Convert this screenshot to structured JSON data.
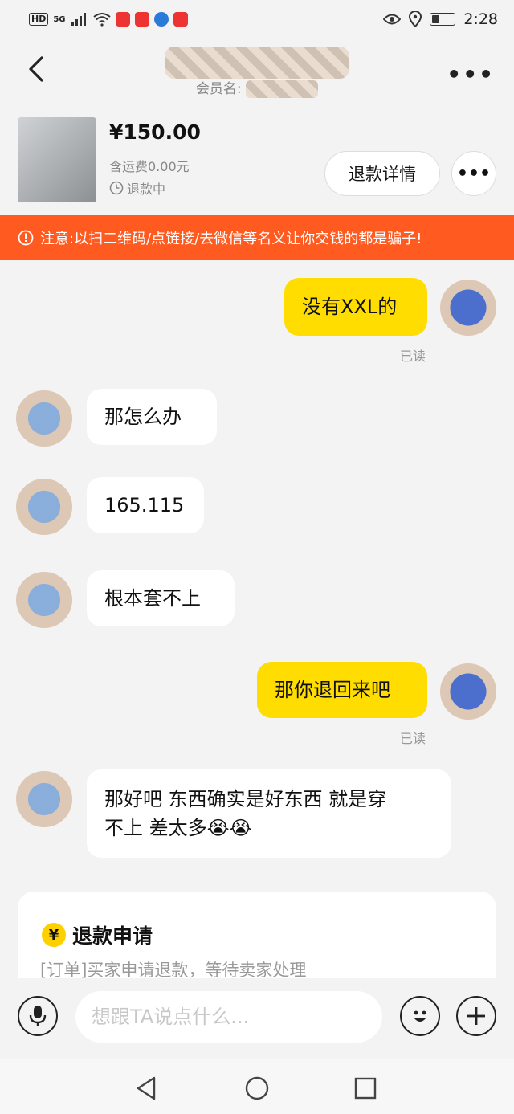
{
  "status_bar": {
    "hd": "HD",
    "signal": "5G",
    "time": "2:28"
  },
  "header": {
    "back_icon": "chevron-left-icon",
    "member_label": "会员名:",
    "more_icon": "more-horizontal-icon"
  },
  "product": {
    "price": "¥150.00",
    "shipping": "含运费0.00元",
    "status": "退款中",
    "refund_detail_button": "退款详情",
    "more_button": "•••"
  },
  "warning": {
    "icon": "alert-circle-icon",
    "text": "注意:以扫二维码/点链接/去微信等名义让你交钱的都是骗子!"
  },
  "messages": [
    {
      "from": "me",
      "text": "没有XXL的",
      "status": "已读"
    },
    {
      "from": "them",
      "text": "那怎么办"
    },
    {
      "from": "them",
      "text": "165.115"
    },
    {
      "from": "them",
      "text": "根本套不上"
    },
    {
      "from": "me",
      "text": "那你退回来吧",
      "status": "已读"
    },
    {
      "from": "them",
      "line1": "那好吧 东西确实是好东西 就是穿",
      "line2": "不上 差太多😭😭"
    }
  ],
  "refund_card": {
    "icon_symbol": "¥",
    "title": "退款申请",
    "description": "[订单]买家申请退款，等待卖家处理"
  },
  "input_bar": {
    "placeholder": "想跟TA说点什么..."
  },
  "colors": {
    "accent_yellow": "#ffdd00",
    "warning_orange": "#ff5a1f",
    "background": "#f3f3f3"
  }
}
